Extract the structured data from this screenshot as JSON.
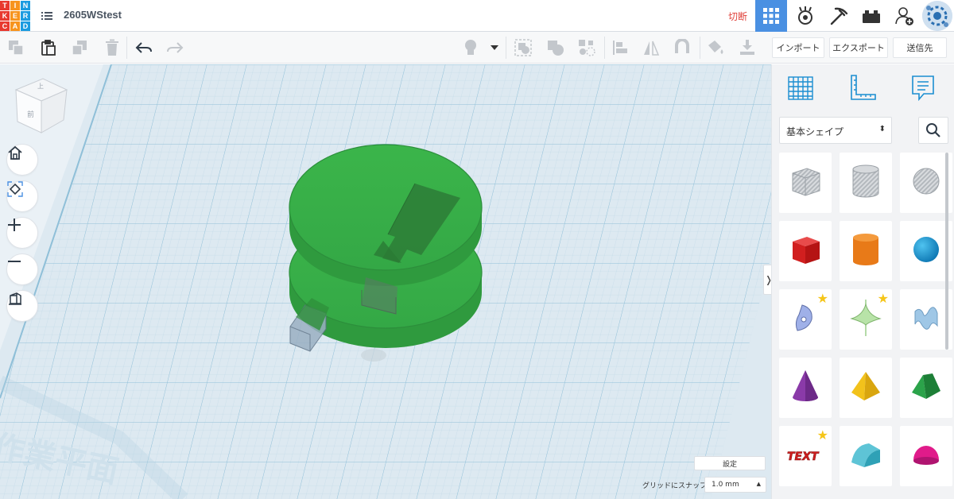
{
  "app": {
    "logo_letters": [
      "T",
      "I",
      "N",
      "K",
      "E",
      "R",
      "C",
      "A",
      "D"
    ],
    "logo_colors": [
      "#e8392f",
      "#f7941e",
      "#1b9be0",
      "#e8392f",
      "#f7941e",
      "#1b9be0",
      "#e8392f",
      "#f7941e",
      "#1b9be0"
    ],
    "project_title": "2605WStest",
    "cut_label": "切断",
    "accent_color": "#4a90e2"
  },
  "toolbar": {
    "import_label": "インポート",
    "export_label": "エクスポート",
    "send_label": "送信先"
  },
  "viewcube": {
    "top_label": "上",
    "front_label": "前"
  },
  "workplane": {
    "label": "作業平面"
  },
  "shape_panel": {
    "category": "基本シェイプ",
    "tiles": [
      {
        "icon": "box-hole-icon",
        "favorite": false
      },
      {
        "icon": "cylinder-hole-icon",
        "favorite": false
      },
      {
        "icon": "sphere-hole-icon",
        "favorite": false
      },
      {
        "icon": "box-icon",
        "favorite": false
      },
      {
        "icon": "cylinder-icon",
        "favorite": false
      },
      {
        "icon": "sphere-icon",
        "favorite": false
      },
      {
        "icon": "scribble-icon",
        "favorite": true
      },
      {
        "icon": "shape-generator-icon",
        "favorite": true
      },
      {
        "icon": "text-3d-icon",
        "favorite": false
      },
      {
        "icon": "cone-icon",
        "favorite": false
      },
      {
        "icon": "pyramid-icon",
        "favorite": false
      },
      {
        "icon": "roof-icon",
        "favorite": false
      },
      {
        "icon": "text-icon",
        "favorite": true
      },
      {
        "icon": "half-cylinder-icon",
        "favorite": false
      },
      {
        "icon": "half-sphere-icon",
        "favorite": false
      }
    ],
    "text_tile_label": "TEXT"
  },
  "bottom": {
    "settings_label": "設定",
    "snap_label": "グリッドにスナップ",
    "snap_value": "1.0 mm"
  }
}
